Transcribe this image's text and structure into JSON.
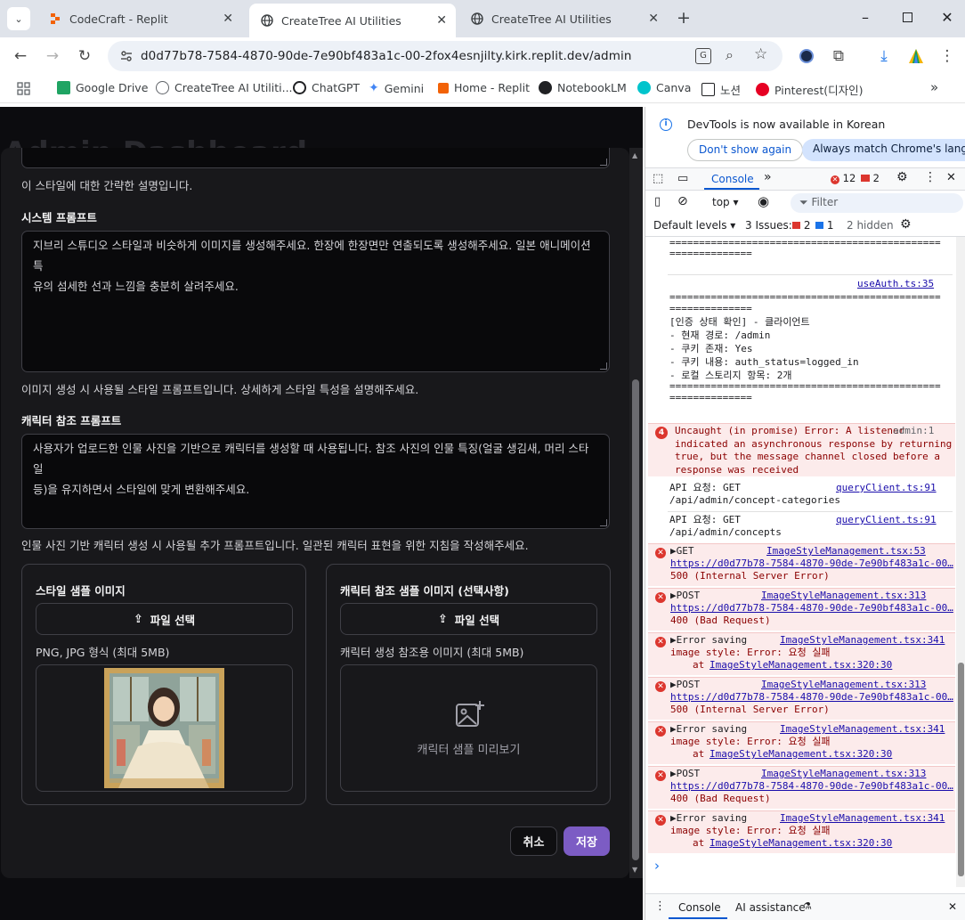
{
  "browser": {
    "tabs": [
      {
        "title": "CodeCraft - Replit",
        "active": false
      },
      {
        "title": "CreateTree AI Utilities",
        "active": true
      },
      {
        "title": "CreateTree AI Utilities",
        "active": false
      }
    ],
    "new_tab_symbol": "+",
    "url": "d0d77b78-7584-4870-90de-7e90bf483a1c-00-2fox4esnjilty.kirk.replit.dev/admin",
    "bookmarks": [
      {
        "label": "Google Drive",
        "color": "#1fa463"
      },
      {
        "label": "CreateTree AI Utiliti...",
        "color": "#5f6368"
      },
      {
        "label": "ChatGPT",
        "color": "#202124"
      },
      {
        "label": "Gemini",
        "color": "#4285f4"
      },
      {
        "label": "Home - Replit",
        "color": "#f26207"
      },
      {
        "label": "NotebookLM",
        "color": "#202124"
      },
      {
        "label": "Canva",
        "color": "#00c4cc"
      },
      {
        "label": "노션",
        "color": "#202124"
      },
      {
        "label": "Pinterest(디자인)",
        "color": "#e60023"
      }
    ],
    "more_bookmarks": "»"
  },
  "page": {
    "bg_title": "Admin Dashboard",
    "form": {
      "description_help": "이 스타일에 대한 간략한 설명입니다.",
      "system_prompt_label": "시스템 프롬프트",
      "system_prompt_value_line1": "지브리 스튜디오 스타일과 비슷하게 이미지를 생성해주세요. 한장에 한장면만 연출되도록 생성해주세요. 일본 애니메이션 특",
      "system_prompt_value_line2": "유의 섬세한 선과 느낌을 충분히 살려주세요.",
      "system_prompt_help": "이미지 생성 시 사용될 스타일 프롬프트입니다. 상세하게 스타일 특성을 설명해주세요.",
      "character_prompt_label": "캐릭터 참조 프롬프트",
      "character_prompt_value_line1": "사용자가 업로드한 인물 사진을 기반으로 캐릭터를 생성할 때 사용됩니다. 참조 사진의 인물 특징(얼굴 생김새, 머리 스타일",
      "character_prompt_value_line2": "등)을 유지하면서 스타일에 맞게 변환해주세요.",
      "character_prompt_help": "인물 사진 기반 캐릭터 생성 시 사용될 추가 프롬프트입니다. 일관된 캐릭터 표현을 위한 지침을 작성해주세요.",
      "style_sample_title": "스타일 샘플 이미지",
      "style_sample_button": "파일 선택",
      "style_sample_help": "PNG, JPG 형식 (최대 5MB)",
      "char_sample_title": "캐릭터 참조 샘플 이미지 (선택사항)",
      "char_sample_button": "파일 선택",
      "char_sample_help": "캐릭터 생성 참조용 이미지 (최대 5MB)",
      "char_sample_placeholder": "캐릭터 샘플 미리보기",
      "cancel_label": "취소",
      "save_label": "저장",
      "save_color": "#7c5cc4"
    }
  },
  "devtools": {
    "banner_text": "DevTools is now available in Korean",
    "dont_show": "Don't show again",
    "always_match": "Always match Chrome's language",
    "tabs": {
      "console": "Console",
      "more": "»"
    },
    "error_count": "12",
    "warn_count": "2",
    "context": "top",
    "filter_placeholder": "Filter",
    "default_levels": "Default levels",
    "issues_label": "3 Issues:",
    "issues_err": "2",
    "issues_info": "1",
    "hidden": "2 hidden",
    "console": {
      "sep_line": "==============================================",
      "sep_short": "==============",
      "useauth_link": "useAuth.ts:35",
      "auth_title": "[인증 상태 확인] - 클라이언트",
      "auth_path": "- 현재 경로: /admin",
      "auth_cookie": "- 쿠키 존재: Yes",
      "auth_cookie_content": "- 쿠키 내용: auth_status=logged_in",
      "auth_storage": "- 로컬 스토리지 항목: 2개",
      "uncaught_count": "4",
      "uncaught_text": "Uncaught (in promise) Error: A listener\nindicated an asynchronous response by returning\ntrue, but the message channel closed before a\nresponse was received",
      "uncaught_src": "admin:1",
      "api1": "API 요청: GET\n/api/admin/concept-categories",
      "api1_link": "queryClient.ts:91",
      "api2": "API 요청: GET\n/api/admin/concepts",
      "api2_link": "queryClient.ts:91",
      "e1_text": "▶GET",
      "e1_link": "ImageStyleManagement.tsx:53",
      "e1_url": "https://d0d77b78-7584-4870-90de-7e90bf483a1c-00…",
      "e1_status": "500 (Internal Server Error)",
      "e2_text": "▶POST",
      "e2_link": "ImageStyleManagement.tsx:313",
      "e2_url": "https://d0d77b78-7584-4870-90de-7e90bf483a1c-00…",
      "e2_status": "400 (Bad Request)",
      "e3_text": "▶Error saving",
      "e3_link": "ImageStyleManagement.tsx:341",
      "e3_msg": "image style: Error: 요청 실패",
      "e3_at": "at",
      "e3_at_link": "ImageStyleManagement.tsx:320:30",
      "e4_text": "▶POST",
      "e4_link": "ImageStyleManagement.tsx:313",
      "e4_url": "https://d0d77b78-7584-4870-90de-7e90bf483a1c-00…",
      "e4_status": "500 (Internal Server Error)",
      "e5_text": "▶Error saving",
      "e5_link": "ImageStyleManagement.tsx:341",
      "e5_msg": "image style: Error: 요청 실패",
      "e5_at": "at",
      "e5_at_link": "ImageStyleManagement.tsx:320:30",
      "e6_text": "▶POST",
      "e6_link": "ImageStyleManagement.tsx:313",
      "e6_url": "https://d0d77b78-7584-4870-90de-7e90bf483a1c-00…",
      "e6_status": "400 (Bad Request)",
      "e7_text": "▶Error saving",
      "e7_link": "ImageStyleManagement.tsx:341",
      "e7_msg": "image style: Error: 요청 실패",
      "e7_at": "at",
      "e7_at_link": "ImageStyleManagement.tsx:320:30",
      "prompt": "›"
    },
    "drawer": {
      "console": "Console",
      "ai": "AI assistance"
    }
  }
}
